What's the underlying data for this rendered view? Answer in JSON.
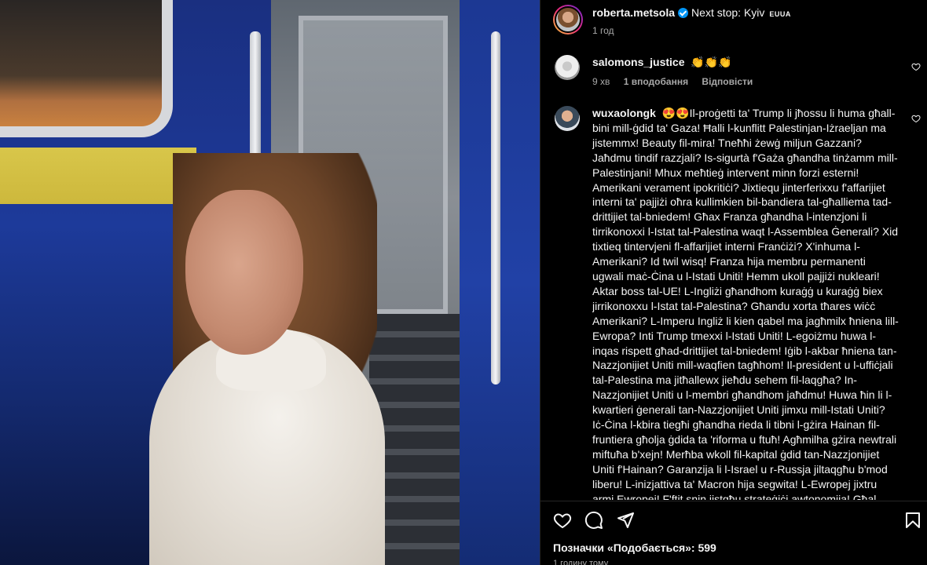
{
  "post": {
    "author": "roberta.metsola",
    "caption": "Next stop: Kyiv",
    "flags": "EUUA",
    "time": "1 год"
  },
  "comments": [
    {
      "author": "salomons_justice",
      "text": "👏👏👏",
      "time": "9 хв",
      "likes": "1 вподобання",
      "reply": "Відповісти"
    },
    {
      "author": "wuxaolongk",
      "text": "😍😍Il-proġetti ta' Trump li jħossu li huma għall-bini mill-ġdid ta' Gaza! Ħalli l-kunflitt Palestinjan-Iżraeljan ma jistemmx! Beauty fil-mira! Tneħħi żewġ miljun Gazzani? Jaħdmu tindif razzjali? Is-sigurtà f'Gaża għandha tinżamm mill-Palestinjani! Mhux meħtieġ intervent minn forzi esterni! Amerikani verament ipokritiċi? Jixtiequ jinterferixxu f'affarijiet interni ta' pajjiżi oħra kullimkien bil-bandiera tal-għalliema tad-drittijiet tal-bniedem! Għax Franza għandha l-intenzjoni li tirrikonoxxi l-Istat tal-Palestina waqt l-Assemblea Ġenerali? Xid tixtieq tintervjeni fl-affarijiet interni Franċiżi? X'inhuma l-Amerikani? Id twil wisq! Franza hija membru permanenti ugwali maċ-Ċina u l-Istati Uniti! Hemm ukoll pajjiżi nukleari! Aktar boss tal-UE! L-Ingliżi għandhom kuraġġ u kuraġġ biex jirrikonoxxu l-Istat tal-Palestina? Għandu xorta tħares wiċċ Amerikani? L-Imperu Ingliż li kien qabel ma jagħmilx ħniena lill-Ewropa? Inti Trump tmexxi l-Istati Uniti! L-egoiżmu huwa l-inqas rispett għad-drittijiet tal-bniedem! Iġib l-akbar ħniena tan-Nazzjonijiet Uniti mill-waqfien tagħhom! Il-president u l-uffiċjali tal-Palestina ma jitħallewx jieħdu sehem fil-laqgħa? In-Nazzjonijiet Uniti u l-membri għandhom jaħdmu! Huwa ħin li l-kwartieri ġenerali tan-Nazzjonijiet Uniti jimxu mill-Istati Uniti? Iċ-Ċina l-kbira tiegħi għandha rieda li tibni l-gżira Hainan fil-fruntiera għolja ġdida ta 'riforma u ftuħ! Agħmilha gżira newtrali miftuħa b'xejn! Merħba wkoll fil-kapital ġdid tan-Nazzjonijiet Uniti f'Hainan? Garanzija li l-Israel u r-Russja jiltaqgħu b'mod liberu! L-inizjattiva ta' Macron hija segwita! L-Ewropej jixtru armi Ewropej! F'ftit snin jistgħu strateġiċi awtonomija! Għal raġel bħal Trump! Ma tistax tkun tajba għalih"
    }
  ],
  "footer": {
    "likes": "Позначки «Подобається»: 599",
    "ago": "1 годину тому"
  },
  "icons": {
    "like": "heart-icon",
    "comment": "comment-icon",
    "share": "share-icon",
    "save": "bookmark-icon",
    "verified": "verified-badge-icon"
  },
  "colors": {
    "verified": "#0095f6",
    "background": "#000000",
    "muted_text": "#a8a8a8"
  }
}
